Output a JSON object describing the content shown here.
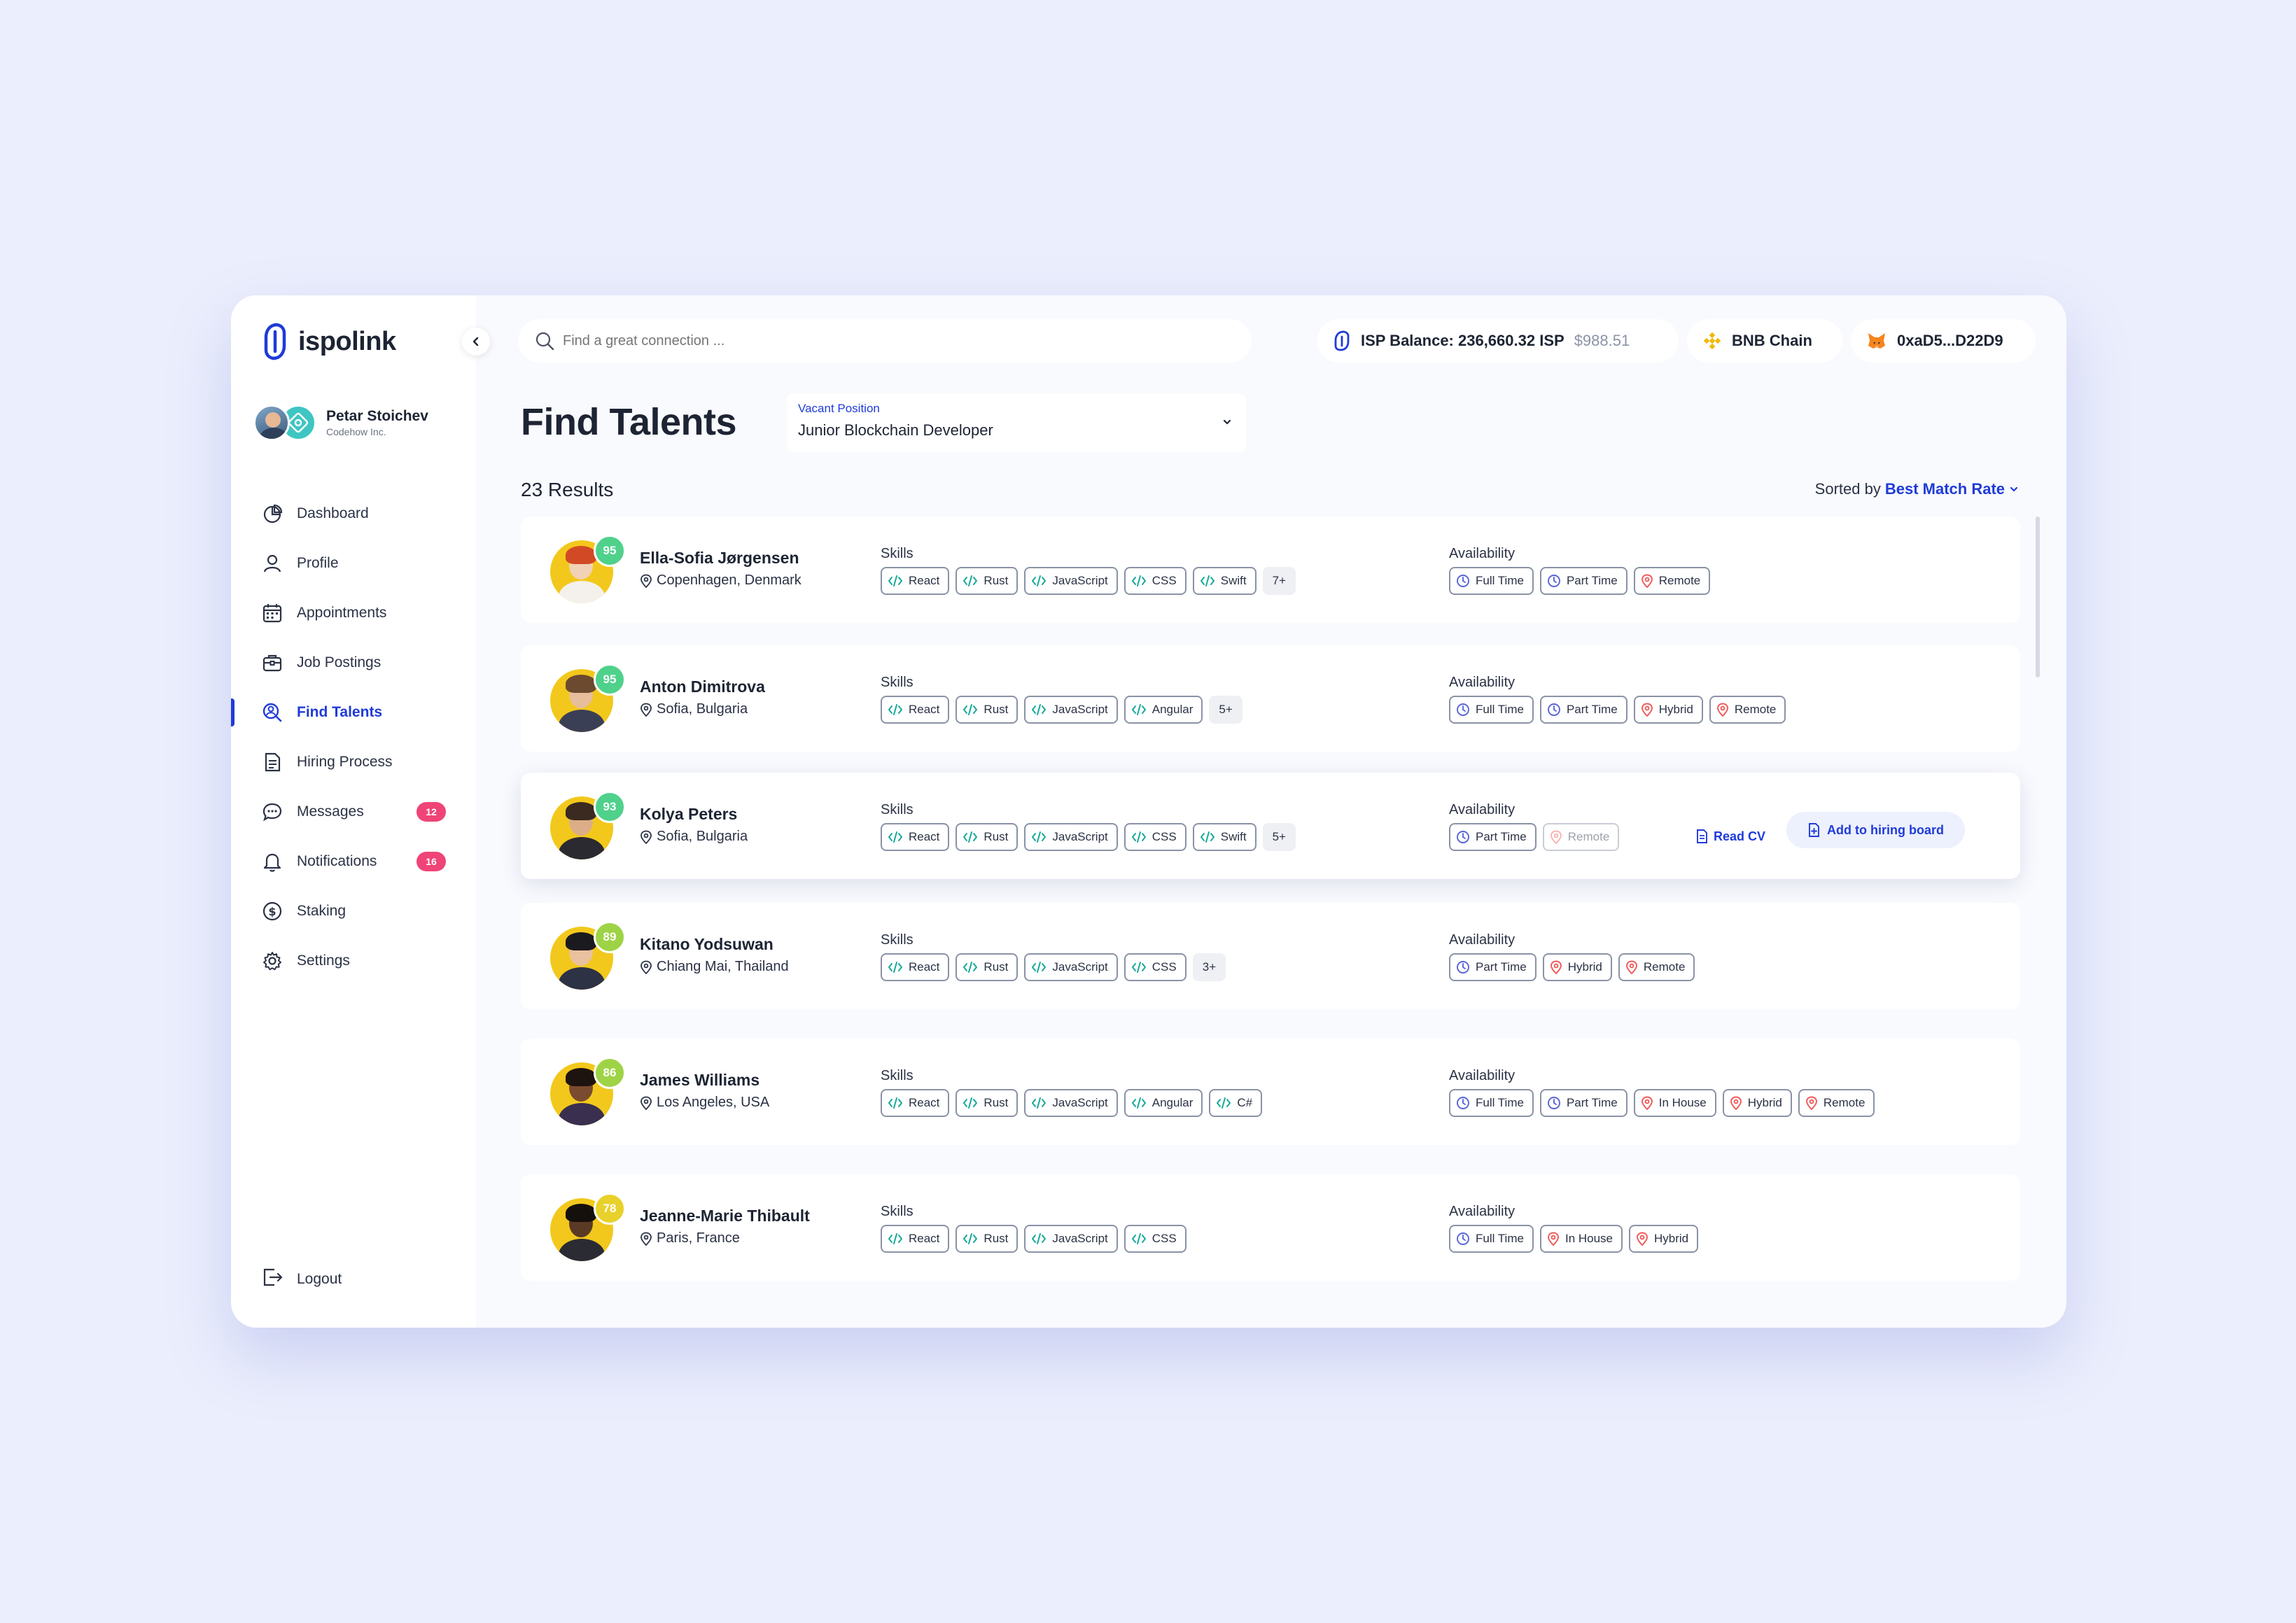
{
  "app": {
    "name": "ispolink"
  },
  "user": {
    "name": "Petar Stoichev",
    "company": "Codehow Inc."
  },
  "nav": [
    {
      "label": "Dashboard",
      "icon": "pie-chart-icon"
    },
    {
      "label": "Profile",
      "icon": "user-icon"
    },
    {
      "label": "Appointments",
      "icon": "calendar-icon"
    },
    {
      "label": "Job Postings",
      "icon": "briefcase-icon"
    },
    {
      "label": "Find Talents",
      "icon": "search-user-icon",
      "active": true
    },
    {
      "label": "Hiring Process",
      "icon": "document-icon"
    },
    {
      "label": "Messages",
      "icon": "chat-icon",
      "badge": "12"
    },
    {
      "label": "Notifications",
      "icon": "bell-icon",
      "badge": "16"
    },
    {
      "label": "Staking",
      "icon": "dollar-icon"
    },
    {
      "label": "Settings",
      "icon": "gear-icon"
    }
  ],
  "logout_label": "Logout",
  "search": {
    "placeholder": "Find a great connection ..."
  },
  "balance": {
    "label": "ISP Balance: 236,660.32 ISP",
    "usd": "$988.51"
  },
  "chain": {
    "label": "BNB Chain"
  },
  "wallet": {
    "label": "0xaD5...D22D9"
  },
  "page": {
    "title": "Find Talents",
    "vacant_label": "Vacant Position",
    "vacant_value": "Junior Blockchain Developer",
    "results": "23 Results",
    "sorted_prefix": "Sorted by",
    "sorted_value": "Best Match Rate"
  },
  "labels": {
    "skills": "Skills",
    "availability": "Availability"
  },
  "actions": {
    "read_cv": "Read CV",
    "add_to_board": "Add to hiring board"
  },
  "colors": {
    "accent": "#1f3bd8",
    "badge": "#ef4477",
    "skill_icon": "#16a99a",
    "clock_icon": "#5865d6",
    "pin_icon": "#ef5a5a"
  },
  "talents": [
    {
      "name": "Ella-Sofia Jørgensen",
      "location": "Copenhagen, Denmark",
      "score": "95",
      "score_color": "#4fd18b",
      "skin": "#f1d2b6",
      "hair": "#d24a25",
      "shirt": "#f4f1ec",
      "skills": [
        "React",
        "Rust",
        "JavaScript",
        "CSS",
        "Swift"
      ],
      "more": "7+",
      "availability": [
        {
          "label": "Full Time",
          "type": "clock"
        },
        {
          "label": "Part Time",
          "type": "clock"
        },
        {
          "label": "Remote",
          "type": "pin"
        }
      ]
    },
    {
      "name": "Anton Dimitrova",
      "location": "Sofia, Bulgaria",
      "score": "95",
      "score_color": "#4fd18b",
      "skin": "#e8bd9b",
      "hair": "#6b4a2f",
      "shirt": "#3b3f55",
      "skills": [
        "React",
        "Rust",
        "JavaScript",
        "Angular"
      ],
      "more": "5+",
      "availability": [
        {
          "label": "Full Time",
          "type": "clock"
        },
        {
          "label": "Part Time",
          "type": "clock"
        },
        {
          "label": "Hybrid",
          "type": "pin"
        },
        {
          "label": "Remote",
          "type": "pin"
        }
      ]
    },
    {
      "name": "Kolya Peters",
      "location": "Sofia, Bulgaria",
      "score": "93",
      "score_color": "#4fd18b",
      "skin": "#dcae88",
      "hair": "#3a2a20",
      "shirt": "#2a2a30",
      "skills": [
        "React",
        "Rust",
        "JavaScript",
        "CSS",
        "Swift"
      ],
      "more": "5+",
      "availability": [
        {
          "label": "Part Time",
          "type": "clock"
        },
        {
          "label": "Remote",
          "type": "pin",
          "fade": true
        }
      ]
    },
    {
      "name": "Kitano Yodsuwan",
      "location": "Chiang Mai, Thailand",
      "score": "89",
      "score_color": "#9fd346",
      "skin": "#e9c19e",
      "hair": "#1b1b1f",
      "shirt": "#2d3244",
      "skills": [
        "React",
        "Rust",
        "JavaScript",
        "CSS"
      ],
      "more": "3+",
      "availability": [
        {
          "label": "Part Time",
          "type": "clock"
        },
        {
          "label": "Hybrid",
          "type": "pin"
        },
        {
          "label": "Remote",
          "type": "pin"
        }
      ]
    },
    {
      "name": "James Williams",
      "location": "Los Angeles, USA",
      "score": "86",
      "score_color": "#9fd346",
      "skin": "#7a4b2e",
      "hair": "#1e140f",
      "shirt": "#3a2f4f",
      "skills": [
        "React",
        "Rust",
        "JavaScript",
        "Angular",
        "C#"
      ],
      "more": "",
      "availability": [
        {
          "label": "Full Time",
          "type": "clock"
        },
        {
          "label": "Part Time",
          "type": "clock"
        },
        {
          "label": "In House",
          "type": "pin"
        },
        {
          "label": "Hybrid",
          "type": "pin"
        },
        {
          "label": "Remote",
          "type": "pin"
        }
      ]
    },
    {
      "name": "Jeanne-Marie Thibault",
      "location": "Paris, France",
      "score": "78",
      "score_color": "#e8d12a",
      "skin": "#5b3a25",
      "hair": "#15100c",
      "shirt": "#2b2b33",
      "skills": [
        "React",
        "Rust",
        "JavaScript",
        "CSS"
      ],
      "more": "",
      "availability": [
        {
          "label": "Full Time",
          "type": "clock"
        },
        {
          "label": "In House",
          "type": "pin"
        },
        {
          "label": "Hybrid",
          "type": "pin"
        }
      ]
    }
  ]
}
